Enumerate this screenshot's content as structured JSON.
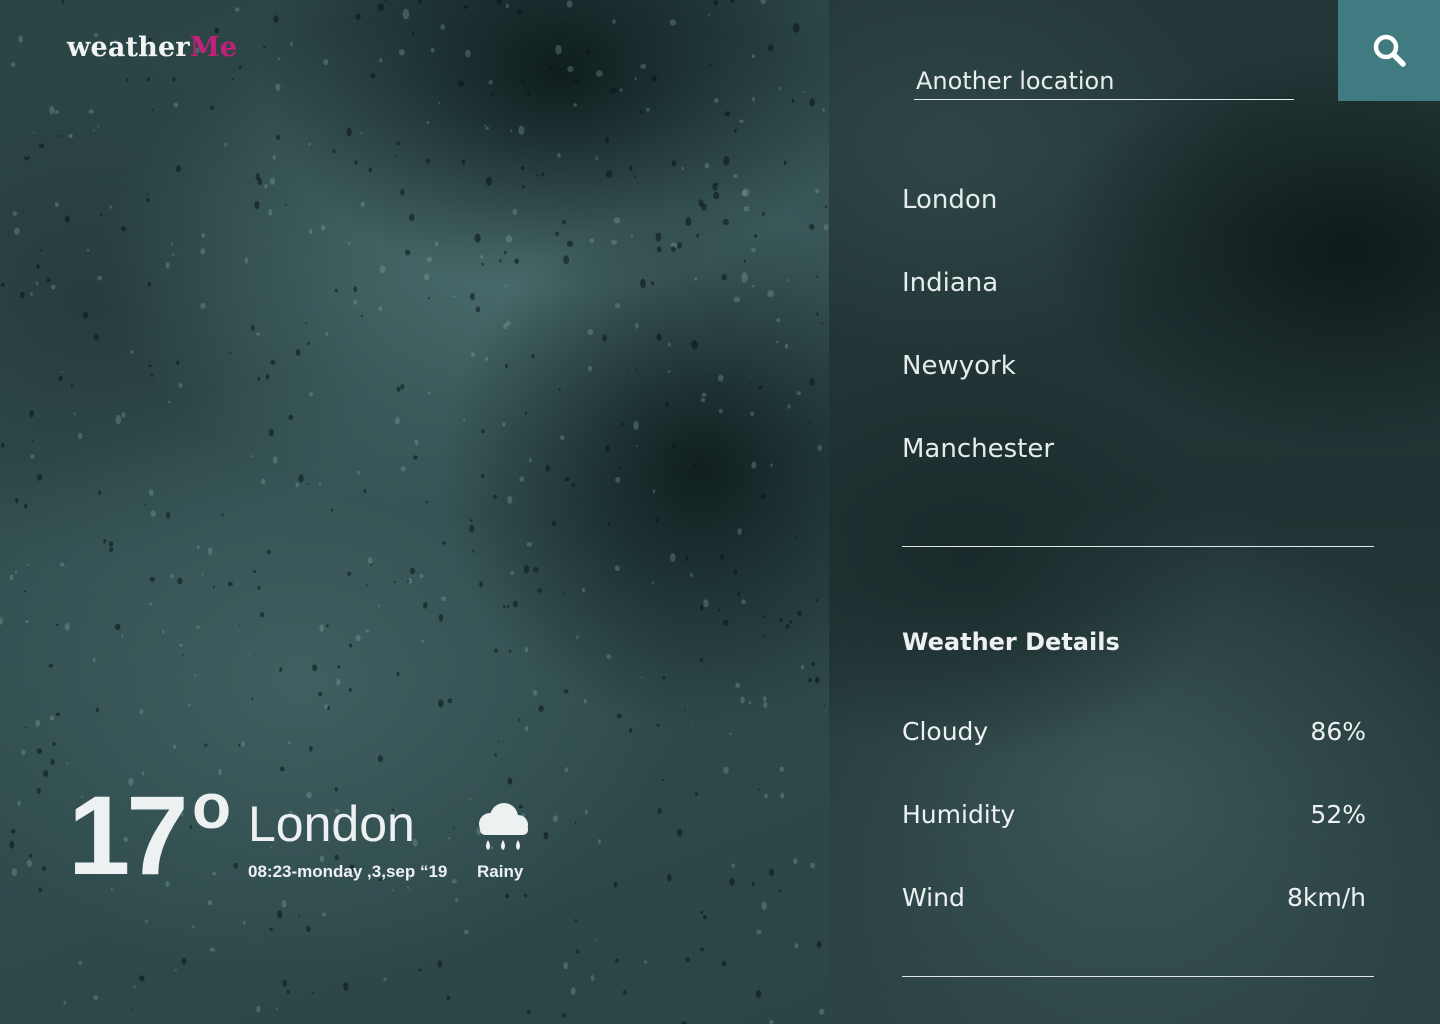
{
  "brand": {
    "logo_main": "weather",
    "logo_accent": "Me",
    "accent_color": "#c2207a"
  },
  "current": {
    "temperature": "17",
    "degree_symbol": "o",
    "city": "London",
    "datetime": "08:23-monday ,3,sep “19",
    "condition": "Rainy",
    "condition_icon": "rain-cloud-icon"
  },
  "search": {
    "placeholder": "Another location",
    "button_icon": "search-icon",
    "button_color": "#3f7b80"
  },
  "locations": [
    "London",
    "Indiana",
    "Newyork",
    "Manchester"
  ],
  "details": {
    "title": "Weather Details",
    "rows": [
      {
        "label": "Cloudy",
        "value": "86%"
      },
      {
        "label": "Humidity",
        "value": "52%"
      },
      {
        "label": "Wind",
        "value": "8km/h"
      }
    ]
  }
}
